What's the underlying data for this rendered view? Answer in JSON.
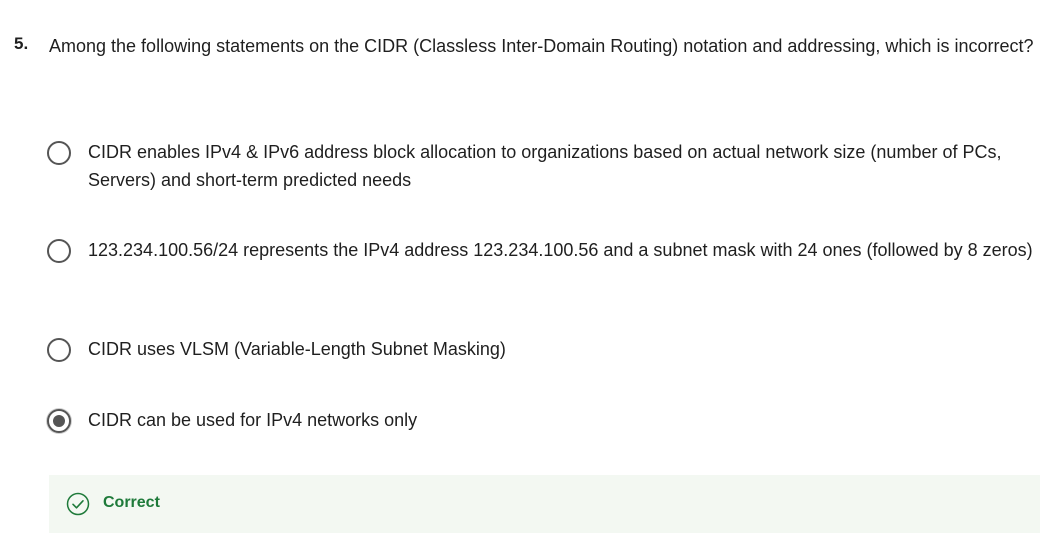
{
  "question": {
    "number": "5.",
    "text": "Among the following statements on the CIDR (Classless Inter-Domain Routing) notation and addressing, which is incorrect?"
  },
  "options": [
    {
      "text": "CIDR enables IPv4 & IPv6 address block allocation to organizations based on actual network size (number of PCs, Servers) and short-term predicted needs",
      "selected": false
    },
    {
      "text": "123.234.100.56/24 represents the IPv4 address 123.234.100.56 and a subnet mask with 24 ones (followed by 8 zeros)",
      "selected": false
    },
    {
      "text": "CIDR uses VLSM (Variable-Length Subnet Masking)",
      "selected": false
    },
    {
      "text": "CIDR can be used for IPv4 networks only",
      "selected": true
    }
  ],
  "feedback": {
    "label": "Correct",
    "icon": "check-circle-icon",
    "color": "#1e7a3a",
    "background": "#f3f8f2"
  }
}
